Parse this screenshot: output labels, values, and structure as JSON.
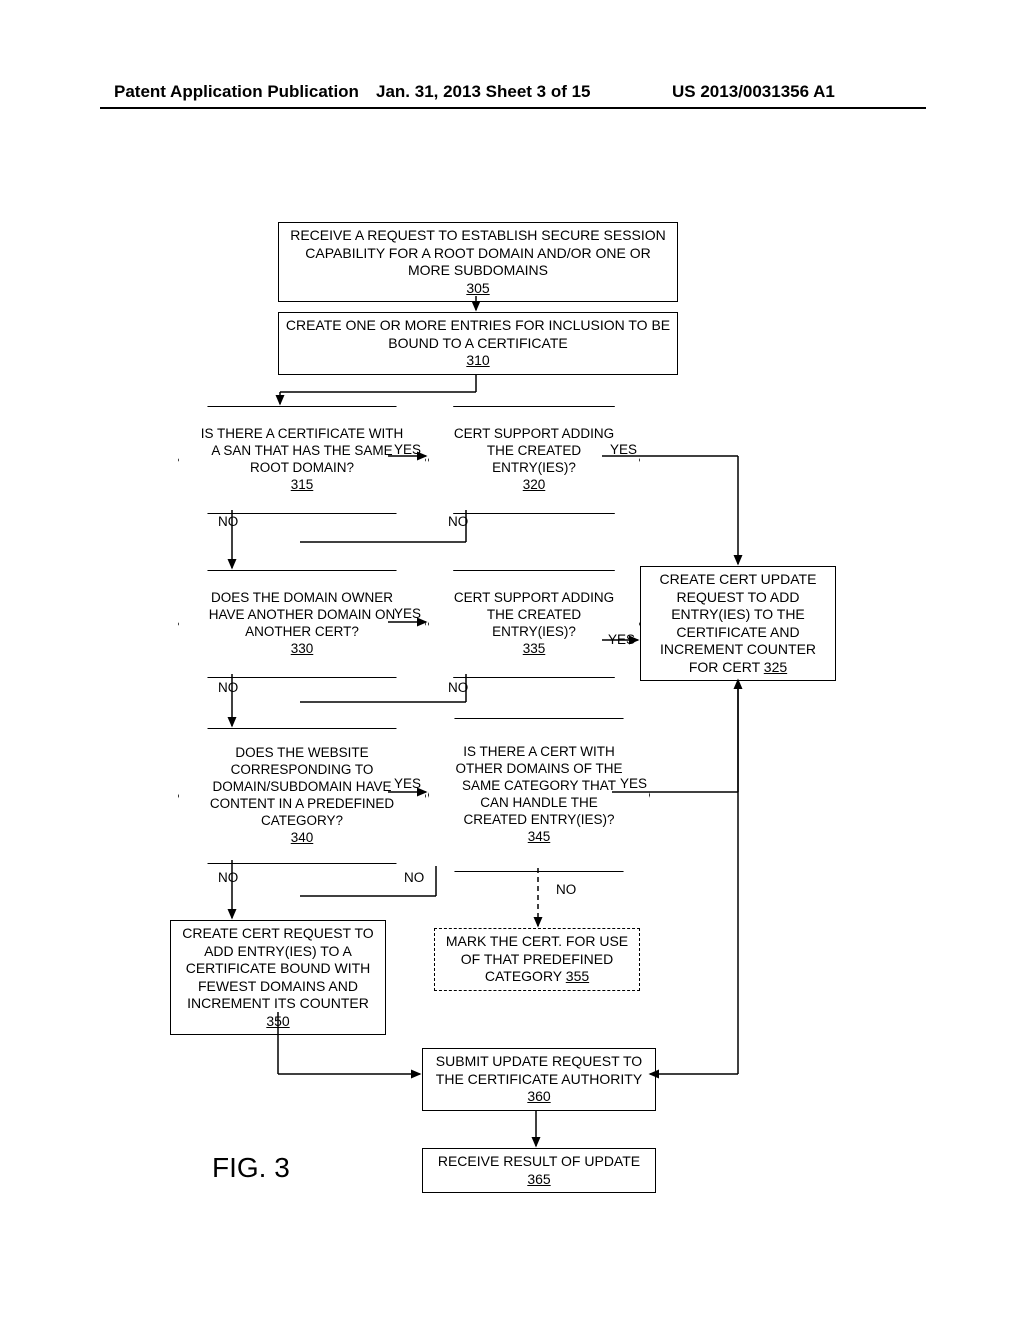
{
  "header": {
    "left": "Patent Application Publication",
    "center": "Jan. 31, 2013  Sheet 3 of 15",
    "right": "US 2013/0031356 A1"
  },
  "figure": {
    "label": "FIG. 3"
  },
  "nodes": {
    "n305": {
      "text": "RECEIVE A REQUEST TO ESTABLISH SECURE SESSION CAPABILITY FOR A ROOT DOMAIN AND/OR ONE OR MORE SUBDOMAINS",
      "ref": "305"
    },
    "n310": {
      "text": "CREATE ONE OR MORE ENTRIES FOR INCLUSION TO BE BOUND TO A CERTIFICATE",
      "ref": "310"
    },
    "n315": {
      "text": "IS THERE A CERTIFICATE WITH A SAN THAT HAS THE SAME ROOT DOMAIN?",
      "ref": "315"
    },
    "n320": {
      "text": "CERT SUPPORT ADDING THE CREATED ENTRY(IES)?",
      "ref": "320"
    },
    "n325": {
      "text": "CREATE CERT UPDATE REQUEST TO ADD ENTRY(IES) TO THE CERTIFICATE AND INCREMENT COUNTER FOR CERT",
      "ref": "325"
    },
    "n330": {
      "text": "DOES THE DOMAIN OWNER HAVE ANOTHER DOMAIN ON ANOTHER CERT?",
      "ref": "330"
    },
    "n335": {
      "text": "CERT SUPPORT ADDING THE CREATED ENTRY(IES)?",
      "ref": "335"
    },
    "n340": {
      "text": "DOES THE WEBSITE CORRESPONDING TO DOMAIN/SUBDOMAIN HAVE CONTENT IN A PREDEFINED CATEGORY?",
      "ref": "340"
    },
    "n345": {
      "text": "IS THERE A CERT WITH OTHER DOMAINS OF THE SAME CATEGORY THAT CAN HANDLE THE CREATED ENTRY(IES)?",
      "ref": "345"
    },
    "n350": {
      "text": "CREATE CERT REQUEST TO ADD ENTRY(IES) TO A CERTIFICATE BOUND WITH FEWEST DOMAINS AND INCREMENT ITS COUNTER",
      "ref": "350"
    },
    "n355": {
      "text": "MARK THE CERT. FOR USE OF THAT PREDEFINED CATEGORY",
      "ref": "355"
    },
    "n360": {
      "text": "SUBMIT UPDATE REQUEST TO THE CERTIFICATE AUTHORITY",
      "ref": "360"
    },
    "n365": {
      "text": "RECEIVE RESULT OF UPDATE",
      "ref": "365"
    }
  },
  "labels": {
    "yes": "YES",
    "no": "NO"
  }
}
